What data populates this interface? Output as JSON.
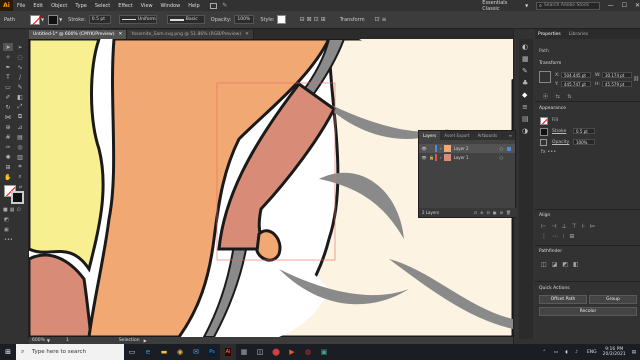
{
  "app": {
    "logo": "Ai"
  },
  "menu": [
    "File",
    "Edit",
    "Object",
    "Type",
    "Select",
    "Effect",
    "View",
    "Window",
    "Help"
  ],
  "workspace": "Essentials Classic",
  "search": {
    "placeholder": "Search Adobe Stock"
  },
  "control": {
    "selection_label": "Path",
    "stroke_label": "Stroke:",
    "stroke_value": "0.5 pt",
    "profile": "Uniform",
    "brush": "Basic",
    "opacity_label": "Opacity:",
    "opacity_value": "100%",
    "style_label": "Style:",
    "transform_label": "Transform"
  },
  "tabs": [
    {
      "label": "Untitled-1* @ 600% (CMYK/Preview)",
      "active": true
    },
    {
      "label": "Yosemite_Sam.svg.png @ 51.86% (RGB/Preview)",
      "active": false
    }
  ],
  "status": {
    "zoom": "600%",
    "page": "1",
    "mode": "Selection"
  },
  "properties": {
    "tabs": [
      "Properties",
      "Libraries"
    ],
    "section": "Path",
    "transform_title": "Transform",
    "x_label": "X:",
    "x": "504.445 pt",
    "y_label": "Y:",
    "y": "445.747 pt",
    "w_label": "W:",
    "w": "30.174 pt",
    "h_label": "H:",
    "h": "45.579 pt",
    "appearance_title": "Appearance",
    "fill_label": "Fill",
    "stroke_label": "Stroke",
    "stroke_value": "0.5 pt",
    "opacity_label": "Opacity",
    "opacity_value": "100%",
    "align_title": "Align",
    "pathfinder_title": "Pathfinder",
    "quick_actions_title": "Quick Actions",
    "offset_path": "Offset Path",
    "group": "Group",
    "recolor": "Recolor"
  },
  "layers_panel": {
    "tabs": [
      "Layers",
      "Asset Export",
      "Artboards"
    ],
    "layers": [
      {
        "name": "Layer 2"
      },
      {
        "name": "Layer 1"
      }
    ],
    "count": "2 Layers"
  },
  "taskbar": {
    "search_placeholder": "Type here to search",
    "lang": "ENG",
    "time": "9:16 PM",
    "date": "20/2/2021"
  },
  "colors": {
    "hair": "#f8f090",
    "skin": "#f2a873",
    "dark_skin": "#d88c78",
    "cream": "#fcf3e2",
    "outline": "#1a1a1a",
    "shadow": "#8a8a8a",
    "accent": "#e36b66",
    "layer2": "#4e8ae0",
    "layer1": "#e05252"
  }
}
